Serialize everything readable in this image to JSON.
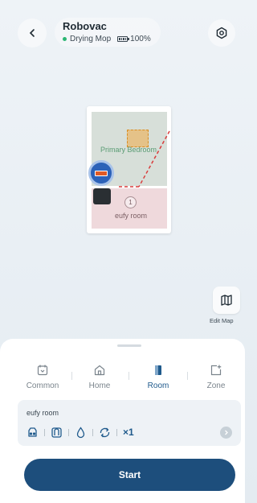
{
  "header": {
    "device_name": "Robovac",
    "status": "Drying Mop",
    "battery": "100%"
  },
  "map": {
    "rooms": [
      {
        "name": "Primary Bedroom"
      },
      {
        "name": "eufy room",
        "number": "1"
      }
    ]
  },
  "edit_map_label": "Edit Map",
  "modes": [
    {
      "label": "Common",
      "icon": "calendar-clean-icon",
      "active": false
    },
    {
      "label": "Home",
      "icon": "home-icon",
      "active": false
    },
    {
      "label": "Room",
      "icon": "room-door-icon",
      "active": true
    },
    {
      "label": "Zone",
      "icon": "zone-add-icon",
      "active": false
    }
  ],
  "room_settings": {
    "room_name": "eufy room",
    "icons": [
      "suction-power-icon",
      "mop-mode-icon",
      "water-level-icon",
      "clean-route-icon"
    ],
    "count": "×1"
  },
  "start_label": "Start",
  "colors": {
    "accent": "#1D4E7C",
    "status_dot": "#2BB673",
    "bedroom": "#D7DFD9",
    "eufy_room": "#EFD9DC"
  }
}
